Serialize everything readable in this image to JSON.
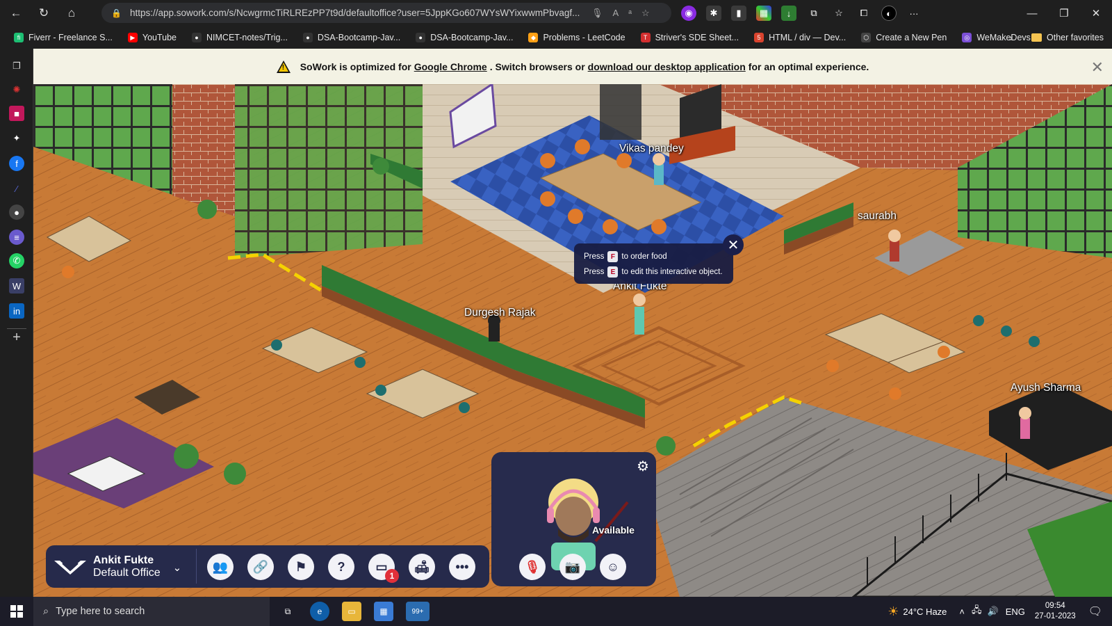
{
  "browser": {
    "url": "https://app.sowork.com/s/NcwgrmcTiRLREzPP7t9d/defaultoffice?user=5JppKGo607WYsWYixwwmPbvagf...",
    "bookmarks": [
      {
        "label": "Fiverr - Freelance S...",
        "color": "#1dbf73",
        "glyph": "fi"
      },
      {
        "label": "YouTube",
        "color": "#ff0000",
        "glyph": "▶"
      },
      {
        "label": "NIMCET-notes/Trig...",
        "color": "#333",
        "glyph": "●"
      },
      {
        "label": "DSA-Bootcamp-Jav...",
        "color": "#333",
        "glyph": "●"
      },
      {
        "label": "DSA-Bootcamp-Jav...",
        "color": "#333",
        "glyph": "●"
      },
      {
        "label": "Problems - LeetCode",
        "color": "#ffa116",
        "glyph": "◆"
      },
      {
        "label": "Striver's SDE Sheet...",
        "color": "#d32f2f",
        "glyph": "T"
      },
      {
        "label": "HTML / div — Dev...",
        "color": "#d9432e",
        "glyph": "5"
      },
      {
        "label": "Create a New Pen",
        "color": "#444",
        "glyph": "⬡"
      },
      {
        "label": "WeMakeDevs",
        "color": "#7b4fd6",
        "glyph": "◎"
      }
    ],
    "other_favorites": "Other favorites"
  },
  "banner": {
    "prefix": "SoWork is optimized for",
    "link1": "Google Chrome",
    "middle": ". Switch browsers or",
    "link2": "download our desktop application",
    "suffix": "for an optimal experience."
  },
  "avatars": [
    {
      "name": "Vikas pandey"
    },
    {
      "name": "saurabh"
    },
    {
      "name": "Ankit Fukte"
    },
    {
      "name": "Durgesh Rajak"
    },
    {
      "name": "Ayush Sharma"
    }
  ],
  "tooltip": {
    "line1_pre": "Press",
    "line1_key": "F",
    "line1_post": "to order food",
    "line2_pre": "Press",
    "line2_key": "E",
    "line2_post": "to edit this interactive object."
  },
  "status": {
    "label": "Available"
  },
  "profile": {
    "name": "Ankit Fukte",
    "office": "Default Office"
  },
  "toolbar": {
    "chat_badge": "1",
    "buttons": [
      "people-icon",
      "link-icon",
      "office-icon",
      "help-icon",
      "chat-icon",
      "furniture-icon",
      "more-icon"
    ],
    "media": [
      "mic-off-icon",
      "camera-off-icon",
      "emoji-icon"
    ]
  },
  "taskbar": {
    "search_placeholder": "Type here to search",
    "weather": "24°C  Haze",
    "lang": "ENG",
    "time": "09:54",
    "date": "27-01-2023",
    "store_badge": "99+"
  },
  "colors": {
    "accent": "#262a4b",
    "banner_bg": "#f3f2e4",
    "floor": "#c97a35"
  }
}
